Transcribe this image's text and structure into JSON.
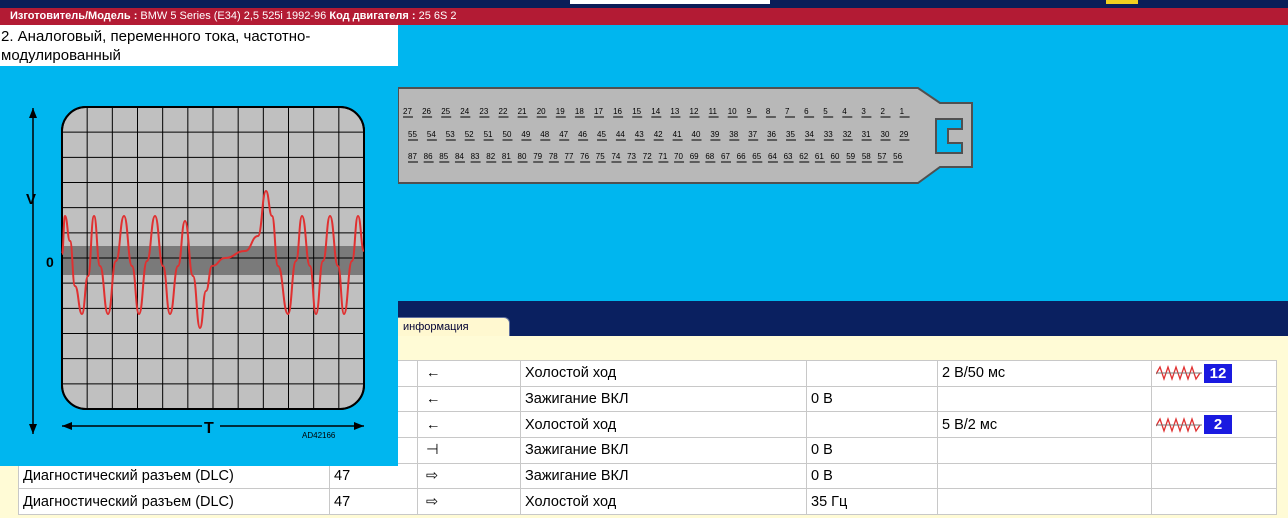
{
  "header": {
    "manufacturer_label": "Изготовитель/Модель :",
    "manufacturer_value": "BMW 5 Series (E34) 2,5 525i 1992-96",
    "engine_label": "Код двигателя :",
    "engine_value": "25 6S 2"
  },
  "scope": {
    "title": "2. Аналоговый, переменного тока, частотно-модулированный",
    "axis_v": "V",
    "axis_zero": "0",
    "axis_t": "T",
    "ref_code": "AD42166"
  },
  "connector": {
    "row1": [
      "27",
      "26",
      "25",
      "24",
      "23",
      "22",
      "21",
      "20",
      "19",
      "18",
      "17",
      "16",
      "15",
      "14",
      "13",
      "12",
      "11",
      "10",
      "9",
      "8",
      "7",
      "6",
      "5",
      "4",
      "3",
      "2",
      "1"
    ],
    "row2": [
      "55",
      "54",
      "53",
      "52",
      "51",
      "50",
      "49",
      "48",
      "47",
      "46",
      "45",
      "44",
      "43",
      "42",
      "41",
      "40",
      "39",
      "38",
      "37",
      "36",
      "35",
      "34",
      "33",
      "32",
      "31",
      "30",
      "29"
    ],
    "row3": [
      "87",
      "86",
      "85",
      "84",
      "83",
      "82",
      "81",
      "80",
      "79",
      "78",
      "77",
      "76",
      "75",
      "74",
      "73",
      "72",
      "71",
      "70",
      "69",
      "68",
      "67",
      "66",
      "65",
      "64",
      "63",
      "62",
      "61",
      "60",
      "59",
      "58",
      "57",
      "56"
    ]
  },
  "tabs": {
    "info_label": "информация"
  },
  "rows": [
    {
      "component": "",
      "pin": "",
      "arrow": "←",
      "condition": "Холостой ход",
      "value": "",
      "spec": "2 В/50 мс",
      "wave": true,
      "badge": "12"
    },
    {
      "component": "",
      "pin": "",
      "arrow": "←",
      "condition": "Зажигание ВКЛ",
      "value": "0 В",
      "spec": "",
      "wave": false,
      "badge": ""
    },
    {
      "component": "",
      "pin": "",
      "arrow": "←",
      "condition": "Холостой ход",
      "value": "",
      "spec": "5 В/2 мс",
      "wave": true,
      "badge": "2"
    },
    {
      "component": "",
      "pin": "",
      "arrow": "⊣",
      "condition": "Зажигание ВКЛ",
      "value": "0 В",
      "spec": "",
      "wave": false,
      "badge": ""
    },
    {
      "component": "Диагностический разъем (DLC)",
      "pin": "47",
      "arrow": "⇨",
      "condition": "Зажигание ВКЛ",
      "value": "0 В",
      "spec": "",
      "wave": false,
      "badge": ""
    },
    {
      "component": "Диагностический разъем (DLC)",
      "pin": "47",
      "arrow": "⇨",
      "condition": "Холостой ход",
      "value": "35 Гц",
      "spec": "",
      "wave": false,
      "badge": ""
    }
  ],
  "colors": {
    "cyan": "#00b6ef",
    "header_red": "#b31b34",
    "navy": "#0a2060",
    "cream": "#fffbd6",
    "trace": "#e03030",
    "badge": "#1a1ae0"
  }
}
